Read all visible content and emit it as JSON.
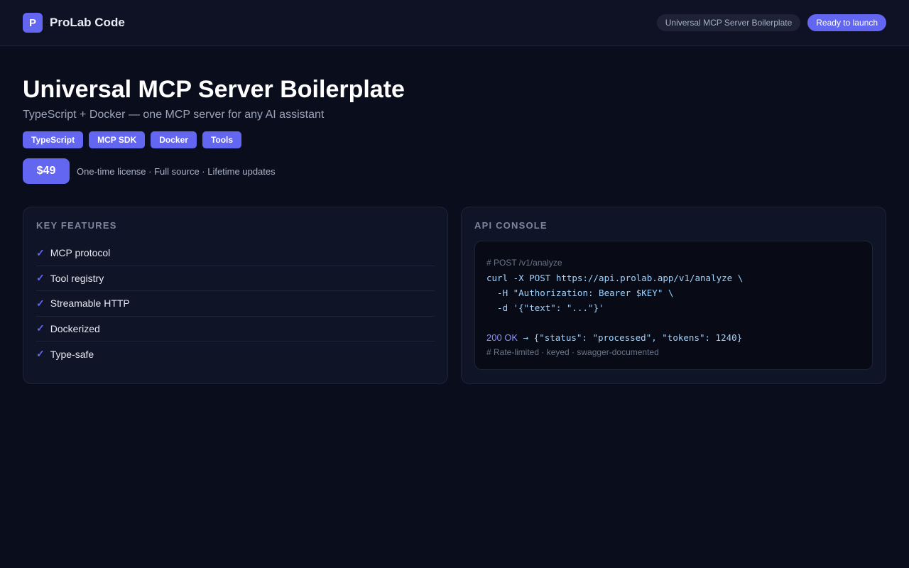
{
  "header": {
    "logo_letter": "P",
    "brand": "ProLab Code",
    "product_pill": "Universal MCP Server Boilerplate",
    "status_button": "Ready to launch"
  },
  "hero": {
    "title": "Universal MCP Server Boilerplate",
    "subtitle": "TypeScript + Docker — one MCP server for any AI assistant",
    "tags": [
      "TypeScript",
      "MCP SDK",
      "Docker",
      "Tools"
    ],
    "price": "$49",
    "price_note": "One-time license · Full source · Lifetime updates"
  },
  "features": {
    "title": "KEY FEATURES",
    "items": [
      "MCP protocol",
      "Tool registry",
      "Streamable HTTP",
      "Dockerized",
      "Type-safe"
    ]
  },
  "console": {
    "title": "API CONSOLE",
    "comment1": "# POST /v1/analyze",
    "line1": "curl -X POST https://api.prolab.app/v1/analyze \\",
    "line2": "  -H \"Authorization: Bearer $KEY\" \\",
    "line3": "  -d '{\"text\": \"...\"}'",
    "status_code": "200 OK",
    "response": " → {\"status\": \"processed\", \"tokens\": 1240}",
    "comment2": "# Rate-limited · keyed · swagger-documented"
  },
  "colors": {
    "accent": "#6366f1",
    "background": "#0a0e1c",
    "card": "#0f1426"
  }
}
